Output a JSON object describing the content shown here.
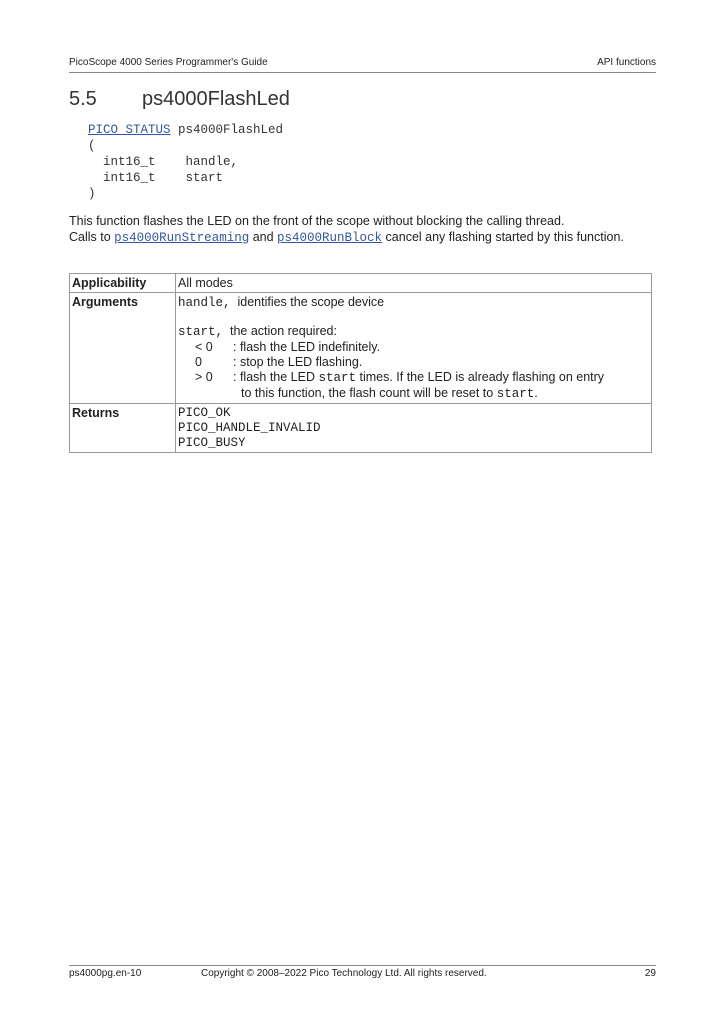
{
  "header": {
    "left": "PicoScope 4000 Series Programmer's Guide",
    "right": "API functions"
  },
  "section": {
    "number": "5.5",
    "title": "ps4000FlashLed"
  },
  "signature": {
    "return_type": "PICO_STATUS",
    "function_name": "ps4000FlashLed",
    "open_paren": "(",
    "params": [
      {
        "type": "int16_t",
        "name": "handle,"
      },
      {
        "type": "int16_t",
        "name": "start"
      }
    ],
    "close_paren": ")"
  },
  "description": {
    "line1": "This function flashes the LED on the front of the scope without blocking the calling thread.",
    "calls_to": "Calls to",
    "link1": "ps4000RunStreaming",
    "and": "and",
    "link2": "ps4000RunBlock",
    "tail": "cancel any flashing started by this function."
  },
  "table": {
    "applicability_label": "Applicability",
    "applicability_value": "All modes",
    "arguments_label": "Arguments",
    "arg_handle_name": "handle,",
    "arg_handle_desc": "identifies the scope device",
    "arg_start_name": "start,",
    "arg_start_desc": "the action required:",
    "options": [
      {
        "cond": "< 0",
        "text": ": flash the LED indefinitely."
      },
      {
        "cond": "0",
        "text": ": stop the LED flashing."
      },
      {
        "cond": "> 0",
        "text_a": ": flash the LED",
        "code": "start",
        "text_b": "times. If the LED is already flashing on entry"
      }
    ],
    "continuation_a": "to this function, the flash count will be reset to",
    "continuation_code": "start",
    "continuation_b": ".",
    "returns_label": "Returns",
    "returns": [
      "PICO_OK",
      "PICO_HANDLE_INVALID",
      "PICO_BUSY"
    ]
  },
  "footer": {
    "left": "ps4000pg.en-10",
    "center": "Copyright © 2008–2022 Pico Technology Ltd. All rights reserved.",
    "right": "29"
  }
}
